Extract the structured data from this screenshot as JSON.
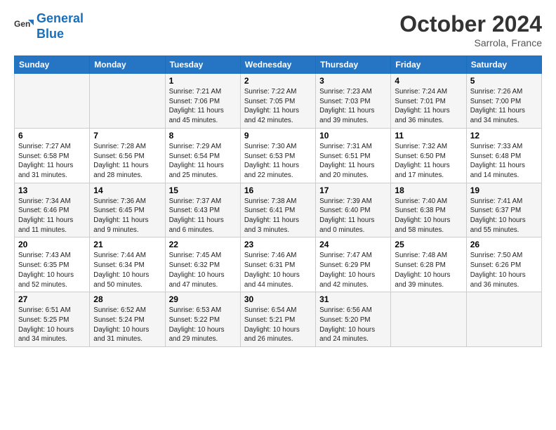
{
  "header": {
    "logo_line1": "General",
    "logo_line2": "Blue",
    "month": "October 2024",
    "location": "Sarrola, France"
  },
  "weekdays": [
    "Sunday",
    "Monday",
    "Tuesday",
    "Wednesday",
    "Thursday",
    "Friday",
    "Saturday"
  ],
  "weeks": [
    [
      {
        "day": "",
        "info": ""
      },
      {
        "day": "",
        "info": ""
      },
      {
        "day": "1",
        "info": "Sunrise: 7:21 AM\nSunset: 7:06 PM\nDaylight: 11 hours and 45 minutes."
      },
      {
        "day": "2",
        "info": "Sunrise: 7:22 AM\nSunset: 7:05 PM\nDaylight: 11 hours and 42 minutes."
      },
      {
        "day": "3",
        "info": "Sunrise: 7:23 AM\nSunset: 7:03 PM\nDaylight: 11 hours and 39 minutes."
      },
      {
        "day": "4",
        "info": "Sunrise: 7:24 AM\nSunset: 7:01 PM\nDaylight: 11 hours and 36 minutes."
      },
      {
        "day": "5",
        "info": "Sunrise: 7:26 AM\nSunset: 7:00 PM\nDaylight: 11 hours and 34 minutes."
      }
    ],
    [
      {
        "day": "6",
        "info": "Sunrise: 7:27 AM\nSunset: 6:58 PM\nDaylight: 11 hours and 31 minutes."
      },
      {
        "day": "7",
        "info": "Sunrise: 7:28 AM\nSunset: 6:56 PM\nDaylight: 11 hours and 28 minutes."
      },
      {
        "day": "8",
        "info": "Sunrise: 7:29 AM\nSunset: 6:54 PM\nDaylight: 11 hours and 25 minutes."
      },
      {
        "day": "9",
        "info": "Sunrise: 7:30 AM\nSunset: 6:53 PM\nDaylight: 11 hours and 22 minutes."
      },
      {
        "day": "10",
        "info": "Sunrise: 7:31 AM\nSunset: 6:51 PM\nDaylight: 11 hours and 20 minutes."
      },
      {
        "day": "11",
        "info": "Sunrise: 7:32 AM\nSunset: 6:50 PM\nDaylight: 11 hours and 17 minutes."
      },
      {
        "day": "12",
        "info": "Sunrise: 7:33 AM\nSunset: 6:48 PM\nDaylight: 11 hours and 14 minutes."
      }
    ],
    [
      {
        "day": "13",
        "info": "Sunrise: 7:34 AM\nSunset: 6:46 PM\nDaylight: 11 hours and 11 minutes."
      },
      {
        "day": "14",
        "info": "Sunrise: 7:36 AM\nSunset: 6:45 PM\nDaylight: 11 hours and 9 minutes."
      },
      {
        "day": "15",
        "info": "Sunrise: 7:37 AM\nSunset: 6:43 PM\nDaylight: 11 hours and 6 minutes."
      },
      {
        "day": "16",
        "info": "Sunrise: 7:38 AM\nSunset: 6:41 PM\nDaylight: 11 hours and 3 minutes."
      },
      {
        "day": "17",
        "info": "Sunrise: 7:39 AM\nSunset: 6:40 PM\nDaylight: 11 hours and 0 minutes."
      },
      {
        "day": "18",
        "info": "Sunrise: 7:40 AM\nSunset: 6:38 PM\nDaylight: 10 hours and 58 minutes."
      },
      {
        "day": "19",
        "info": "Sunrise: 7:41 AM\nSunset: 6:37 PM\nDaylight: 10 hours and 55 minutes."
      }
    ],
    [
      {
        "day": "20",
        "info": "Sunrise: 7:43 AM\nSunset: 6:35 PM\nDaylight: 10 hours and 52 minutes."
      },
      {
        "day": "21",
        "info": "Sunrise: 7:44 AM\nSunset: 6:34 PM\nDaylight: 10 hours and 50 minutes."
      },
      {
        "day": "22",
        "info": "Sunrise: 7:45 AM\nSunset: 6:32 PM\nDaylight: 10 hours and 47 minutes."
      },
      {
        "day": "23",
        "info": "Sunrise: 7:46 AM\nSunset: 6:31 PM\nDaylight: 10 hours and 44 minutes."
      },
      {
        "day": "24",
        "info": "Sunrise: 7:47 AM\nSunset: 6:29 PM\nDaylight: 10 hours and 42 minutes."
      },
      {
        "day": "25",
        "info": "Sunrise: 7:48 AM\nSunset: 6:28 PM\nDaylight: 10 hours and 39 minutes."
      },
      {
        "day": "26",
        "info": "Sunrise: 7:50 AM\nSunset: 6:26 PM\nDaylight: 10 hours and 36 minutes."
      }
    ],
    [
      {
        "day": "27",
        "info": "Sunrise: 6:51 AM\nSunset: 5:25 PM\nDaylight: 10 hours and 34 minutes."
      },
      {
        "day": "28",
        "info": "Sunrise: 6:52 AM\nSunset: 5:24 PM\nDaylight: 10 hours and 31 minutes."
      },
      {
        "day": "29",
        "info": "Sunrise: 6:53 AM\nSunset: 5:22 PM\nDaylight: 10 hours and 29 minutes."
      },
      {
        "day": "30",
        "info": "Sunrise: 6:54 AM\nSunset: 5:21 PM\nDaylight: 10 hours and 26 minutes."
      },
      {
        "day": "31",
        "info": "Sunrise: 6:56 AM\nSunset: 5:20 PM\nDaylight: 10 hours and 24 minutes."
      },
      {
        "day": "",
        "info": ""
      },
      {
        "day": "",
        "info": ""
      }
    ]
  ]
}
